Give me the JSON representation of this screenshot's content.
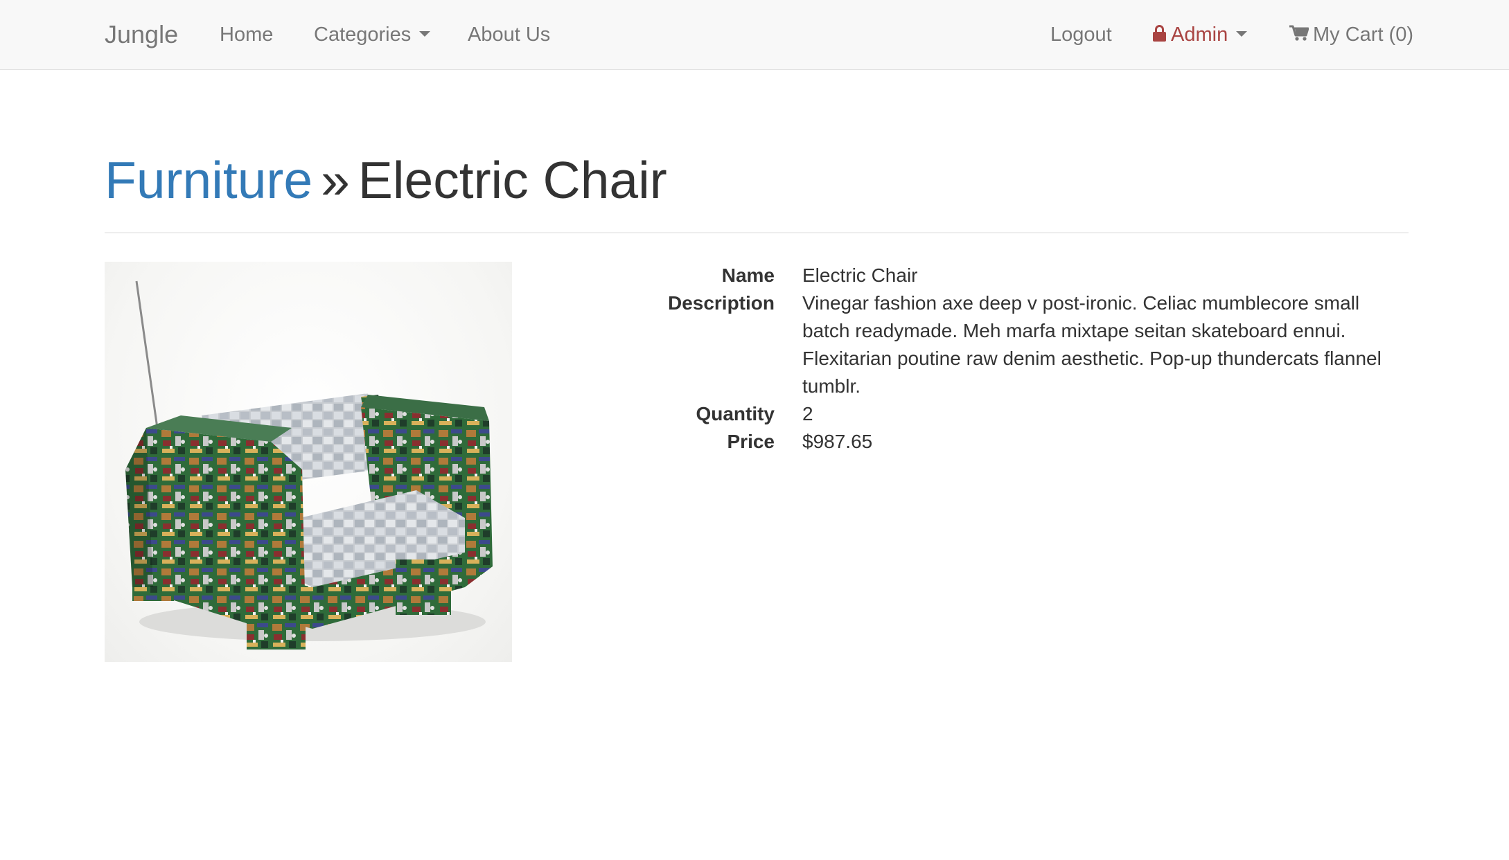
{
  "navbar": {
    "brand": "Jungle",
    "home": "Home",
    "categories": "Categories",
    "about": "About Us",
    "logout": "Logout",
    "admin": "Admin",
    "cart": "My Cart (0)"
  },
  "header": {
    "category": "Furniture",
    "separator": "»",
    "product": "Electric Chair"
  },
  "image": {
    "alt": "Electric Chair"
  },
  "details": {
    "name_label": "Name",
    "name_value": "Electric Chair",
    "description_label": "Description",
    "description_value": "Vinegar fashion axe deep v post-ironic. Celiac mumblecore small batch readymade. Meh marfa mixtape seitan skateboard ennui. Flexitarian poutine raw denim aesthetic. Pop-up thundercats flannel tumblr.",
    "quantity_label": "Quantity",
    "quantity_value": "2",
    "price_label": "Price",
    "price_value": "$987.65"
  },
  "colors": {
    "link": "#337ab7",
    "admin": "#a94442",
    "nav_text": "#777777",
    "navbar_bg": "#f8f8f8"
  }
}
